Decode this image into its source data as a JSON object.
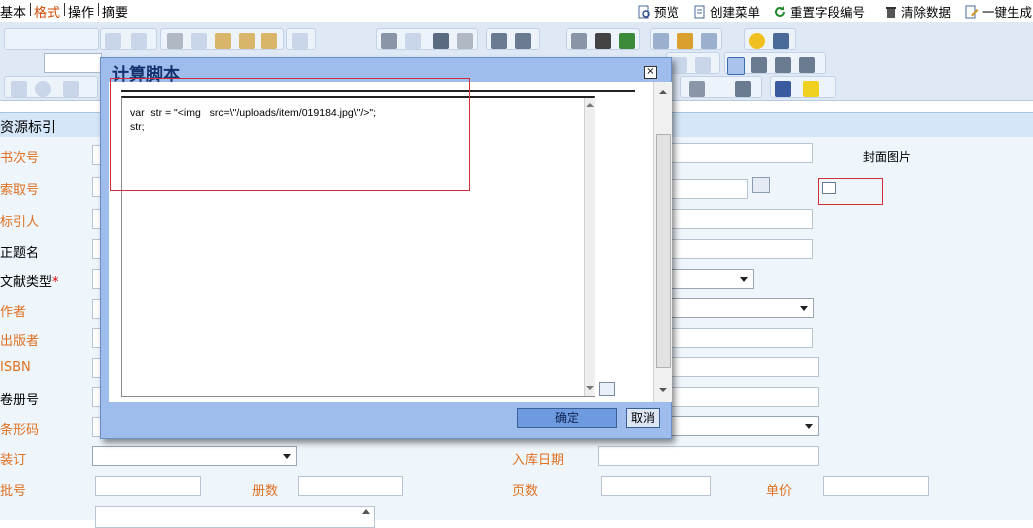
{
  "top_menu": {
    "tabs": [
      {
        "label": "基本",
        "active": false
      },
      {
        "label": "格式",
        "active": true
      },
      {
        "label": "操作",
        "active": false
      },
      {
        "label": "摘要",
        "active": false
      }
    ],
    "actions": {
      "preview": "预览",
      "create_menu": "创建菜单",
      "reset_field_numbers": "重置字段编号",
      "clear_data": "清除数据",
      "one_click_generate": "一键生成"
    }
  },
  "form": {
    "section_title": "资源标引",
    "fields": {
      "call_number_book": {
        "label": "书次号"
      },
      "call_number": {
        "label": "索取号"
      },
      "indexer": {
        "label": "标引人"
      },
      "title_proper": {
        "label": "正题名"
      },
      "document_type": {
        "label": "文献类型",
        "required_mark": "*"
      },
      "author": {
        "label": "作者"
      },
      "publisher": {
        "label": "出版者"
      },
      "isbn": {
        "label": "ISBN"
      },
      "volume_number": {
        "label": "卷册号"
      },
      "barcode": {
        "label": "条形码"
      },
      "binding": {
        "label": "装订"
      },
      "batch_number": {
        "label": "批号"
      },
      "volume_count": {
        "label": "册数"
      },
      "pages": {
        "label": "页数"
      },
      "unit_price": {
        "label": "单价"
      },
      "stock_in_date": {
        "label": "入库日期"
      },
      "cover_image": {
        "label": "封面图片"
      }
    }
  },
  "dialog": {
    "title": "计算脚本",
    "close_glyph": "×",
    "script_lines": [
      "var  str = \"<img   src=\\\"/uploads/item/019184.jpg\\\"/>\";",
      "str;"
    ],
    "ok_label": "确定",
    "cancel_label": "取消"
  },
  "colors": {
    "label_orange": "#e07020",
    "dialog_blue": "#9fbdec",
    "toolbar_blue": "#dfe9f6",
    "highlight_red": "#d0303a"
  }
}
